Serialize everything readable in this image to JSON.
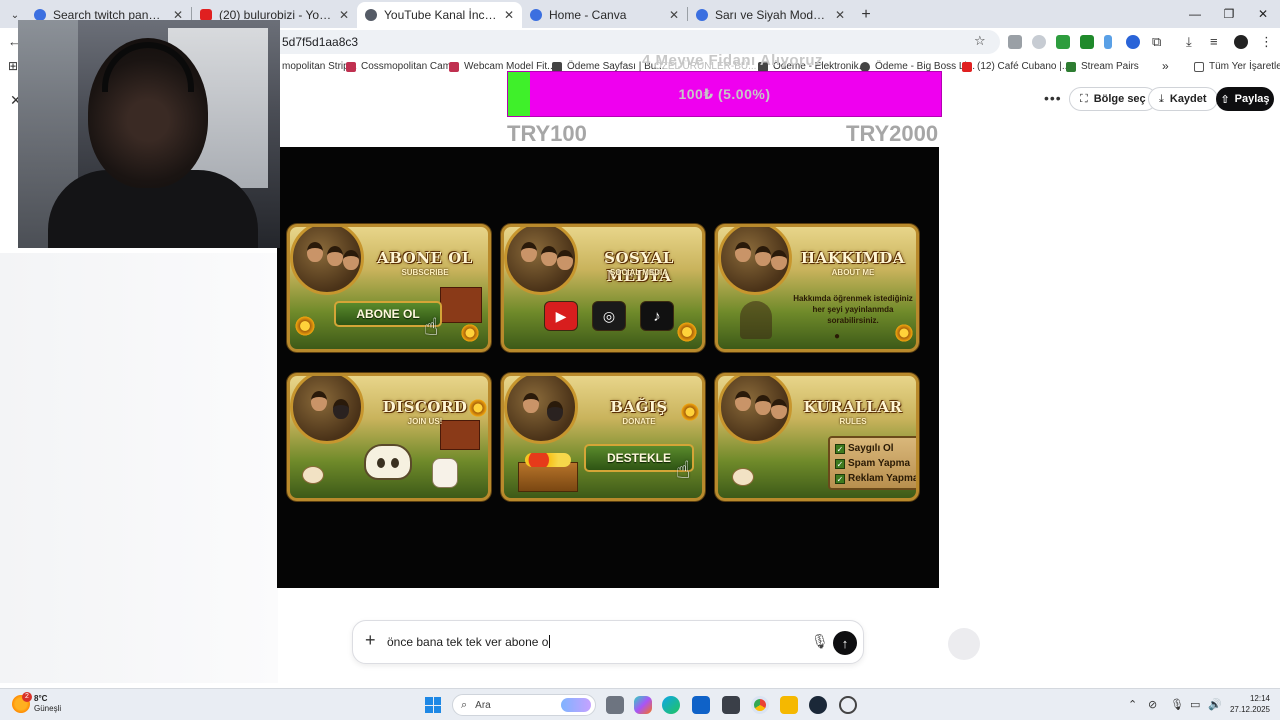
{
  "browser": {
    "tabs": [
      {
        "title": "Search twitch panel - Canva",
        "favicon": "#3b6fe0"
      },
      {
        "title": "(20) bulurobizi - YouTube",
        "favicon": "#e02020"
      },
      {
        "title": "YouTube Kanal İncelemesi",
        "favicon": "#555b66"
      },
      {
        "title": "Home - Canva",
        "favicon": "#3b6fe0"
      },
      {
        "title": "Sarı ve Siyah Modern TV Eğlence",
        "favicon": "#3b6fe0"
      }
    ],
    "active_tab": 2,
    "url": "5d7f5d1aa8c3",
    "bookmarks": [
      {
        "label": "mopolitan Strip...",
        "color": "#c03030"
      },
      {
        "label": "Cossmopolitan Cam...",
        "color": "#c03050"
      },
      {
        "label": "Webcam Model Fit...",
        "color": "#c03050"
      },
      {
        "label": "Ödeme Sayfası | Bu...",
        "color": "#333333"
      },
      {
        "label": "ÖZEL ÜRÜNLER-BÜ...",
        "color": "#333333"
      },
      {
        "label": "Ödeme - Elektronik...",
        "color": "#333333"
      },
      {
        "label": "Ödeme - Big Boss Li...",
        "color": "#333333"
      },
      {
        "label": "(12) Café Cubano |...",
        "color": "#e02020"
      },
      {
        "label": "Stream Pairs",
        "color": "#2e7d32"
      }
    ],
    "all_bookmarks": "Tüm Yer İşaretleri"
  },
  "canva": {
    "region_select": "Bölge seç",
    "save": "Kaydet",
    "share": "Paylaş"
  },
  "goal": {
    "title": "4 Meyve Fidanı Alıyoruz",
    "progress_text": "100₺ (5.00%)",
    "progress_percent": 5,
    "min_label": "TRY100",
    "max_label": "TRY2000"
  },
  "panels": [
    {
      "title": "ABONE OL",
      "subtitle": "SUBSCRIBE",
      "button": "ABONE OL"
    },
    {
      "title": "SOSYAL MEDYA",
      "subtitle": "SOCIAL MEDIA"
    },
    {
      "title": "HAKKIMDA",
      "subtitle": "ABOUT ME",
      "body": "Hakkımda öğrenmek istediğiniz her şeyi yayinlanmda sorabilirsiniz."
    },
    {
      "title": "DISCORD",
      "subtitle": "JOIN US!"
    },
    {
      "title": "BAĞIŞ",
      "subtitle": "DONATE",
      "button": "DESTEKLE"
    },
    {
      "title": "KURALLAR",
      "subtitle": "RULES",
      "rules": [
        "Saygılı Ol",
        "Spam Yapma",
        "Reklam Yapma"
      ]
    }
  ],
  "chat": {
    "input_value": "önce bana tek tek ver abone o"
  },
  "taskbar": {
    "temperature": "8°C",
    "weather": "Güneşli",
    "notification_count": "2",
    "search_placeholder": "Ara",
    "time": "12:14",
    "date": "27.12.2025"
  }
}
